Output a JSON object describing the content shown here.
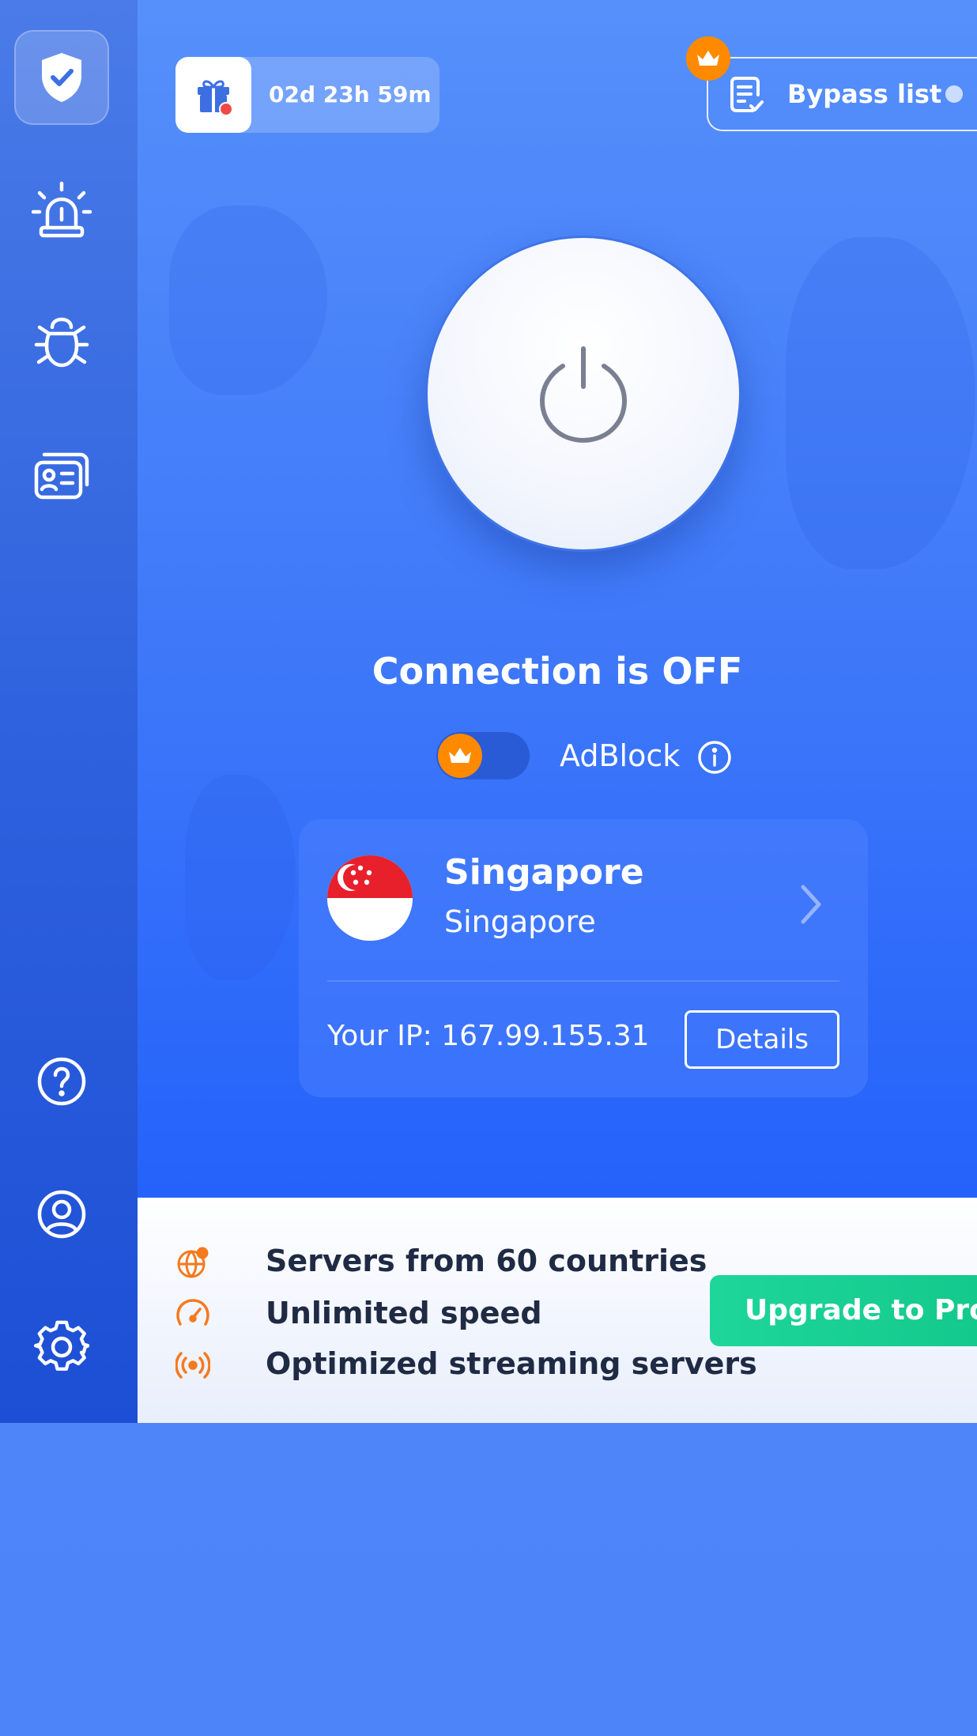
{
  "header": {
    "gift_timer": "02d 23h 59m",
    "bypass_label": "Bypass list"
  },
  "sidebar": {
    "items": [
      {
        "name": "protection",
        "icon": "shield-check-icon",
        "active": true
      },
      {
        "name": "alerts",
        "icon": "alarm-siren-icon"
      },
      {
        "name": "antivirus",
        "icon": "bug-icon"
      },
      {
        "name": "identity",
        "icon": "id-card-icon"
      },
      {
        "name": "help",
        "icon": "question-circle-icon"
      },
      {
        "name": "account",
        "icon": "user-circle-icon"
      },
      {
        "name": "settings",
        "icon": "gear-icon"
      }
    ]
  },
  "connection": {
    "status": "Connection is OFF",
    "adblock_label": "AdBlock",
    "adblock_enabled": false
  },
  "server": {
    "country": "Singapore",
    "city": "Singapore",
    "ip_text": "Your IP: 167.99.155.31",
    "details_label": "Details"
  },
  "promo": {
    "features": [
      "Servers from 60 countries",
      "Unlimited speed",
      "Optimized streaming servers"
    ],
    "upgrade_label": "Upgrade to Pro"
  },
  "colors": {
    "accent": "#2462fb",
    "crown": "#ff8a00",
    "upgrade": "#1ed69a",
    "feature_icon": "#f47a1f"
  }
}
